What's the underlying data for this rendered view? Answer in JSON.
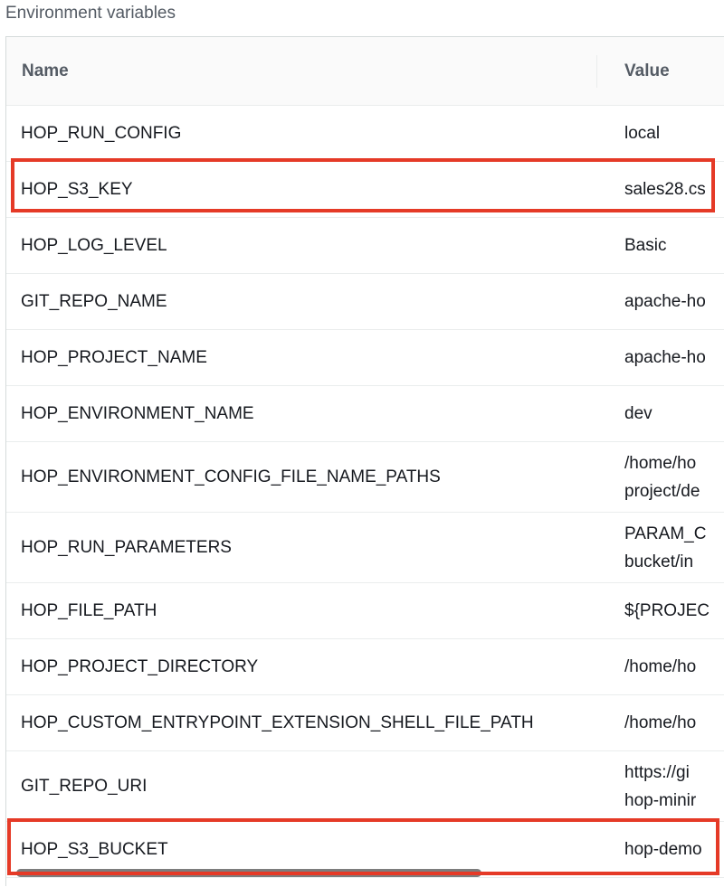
{
  "section": {
    "title": "Environment variables"
  },
  "table": {
    "columns": {
      "name": "Name",
      "value": "Value"
    },
    "rows": [
      {
        "name": "HOP_RUN_CONFIG",
        "value": [
          "local"
        ]
      },
      {
        "name": "HOP_S3_KEY",
        "value": [
          "sales28.cs"
        ],
        "highlighted": true
      },
      {
        "name": "HOP_LOG_LEVEL",
        "value": [
          "Basic"
        ]
      },
      {
        "name": "GIT_REPO_NAME",
        "value": [
          "apache-ho"
        ]
      },
      {
        "name": "HOP_PROJECT_NAME",
        "value": [
          "apache-ho"
        ]
      },
      {
        "name": "HOP_ENVIRONMENT_NAME",
        "value": [
          "dev"
        ]
      },
      {
        "name": "HOP_ENVIRONMENT_CONFIG_FILE_NAME_PATHS",
        "value": [
          "/home/ho",
          "project/de"
        ]
      },
      {
        "name": "HOP_RUN_PARAMETERS",
        "value": [
          "PARAM_C",
          "bucket/in"
        ]
      },
      {
        "name": "HOP_FILE_PATH",
        "value": [
          "${PROJEC"
        ]
      },
      {
        "name": "HOP_PROJECT_DIRECTORY",
        "value": [
          "/home/ho"
        ]
      },
      {
        "name": "HOP_CUSTOM_ENTRYPOINT_EXTENSION_SHELL_FILE_PATH",
        "value": [
          "/home/ho"
        ]
      },
      {
        "name": "GIT_REPO_URI",
        "value": [
          "https://gi",
          "hop-minir"
        ]
      },
      {
        "name": "HOP_S3_BUCKET",
        "value": [
          "hop-demo"
        ],
        "highlighted": true
      }
    ]
  },
  "colors": {
    "highlight": "#e53a27",
    "header_text": "#545b64",
    "row_text": "#16191f",
    "border": "#eaeded"
  }
}
